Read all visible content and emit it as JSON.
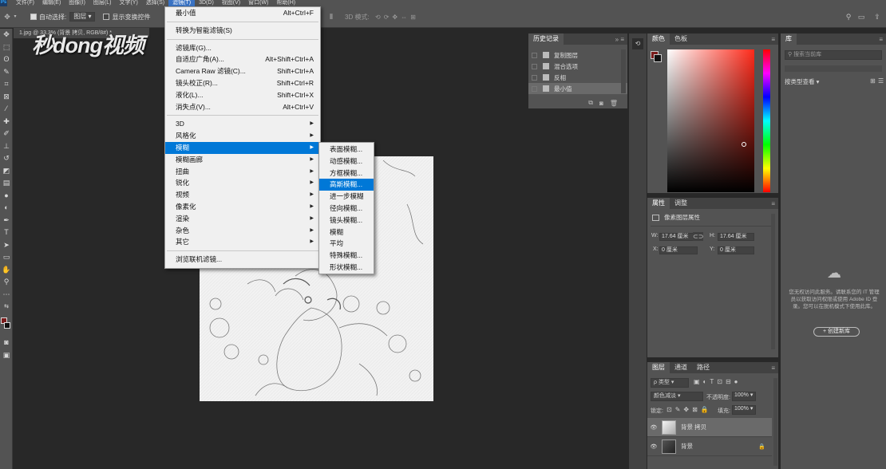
{
  "menubar": {
    "items": [
      "文件(F)",
      "编辑(E)",
      "图像(I)",
      "图层(L)",
      "文字(Y)",
      "选择(S)",
      "滤镜(T)",
      "3D(D)",
      "视图(V)",
      "窗口(W)",
      "帮助(H)"
    ],
    "active_index": 6,
    "app_icon": "Ps"
  },
  "options_bar": {
    "move_icon": "✥",
    "auto_select_label": "自动选择:",
    "auto_select_value": "图层",
    "show_transform_label": "显示变换控件",
    "mode_3d_label": "3D 模式:"
  },
  "document": {
    "tab_label": "1.jpg @ 33.3% (背景 拷贝, RGB/8#) *",
    "watermark": "秒dong视频"
  },
  "filter_menu": {
    "groups": [
      [
        {
          "label": "最小值",
          "shortcut": "Alt+Ctrl+F"
        }
      ],
      [
        {
          "label": "转换为智能滤镜(S)",
          "shortcut": ""
        }
      ],
      [
        {
          "label": "滤镜库(G)...",
          "shortcut": ""
        },
        {
          "label": "自适应广角(A)...",
          "shortcut": "Alt+Shift+Ctrl+A"
        },
        {
          "label": "Camera Raw 滤镜(C)...",
          "shortcut": "Shift+Ctrl+A"
        },
        {
          "label": "镜头校正(R)...",
          "shortcut": "Shift+Ctrl+R"
        },
        {
          "label": "液化(L)...",
          "shortcut": "Shift+Ctrl+X"
        },
        {
          "label": "消失点(V)...",
          "shortcut": "Alt+Ctrl+V"
        }
      ],
      [
        {
          "label": "3D",
          "submenu": true
        },
        {
          "label": "风格化",
          "submenu": true
        },
        {
          "label": "模糊",
          "submenu": true,
          "highlighted": true
        },
        {
          "label": "模糊画廊",
          "submenu": true
        },
        {
          "label": "扭曲",
          "submenu": true
        },
        {
          "label": "锐化",
          "submenu": true
        },
        {
          "label": "视频",
          "submenu": true
        },
        {
          "label": "像素化",
          "submenu": true
        },
        {
          "label": "渲染",
          "submenu": true
        },
        {
          "label": "杂色",
          "submenu": true
        },
        {
          "label": "其它",
          "submenu": true
        }
      ],
      [
        {
          "label": "浏览联机滤镜...",
          "shortcut": ""
        }
      ]
    ]
  },
  "blur_submenu": {
    "items": [
      "表面模糊...",
      "动感模糊...",
      "方框模糊...",
      "高斯模糊...",
      "进一步模糊",
      "径向模糊...",
      "镜头模糊...",
      "模糊",
      "平均",
      "特殊模糊...",
      "形状模糊..."
    ],
    "highlighted_index": 3
  },
  "history_panel": {
    "title": "历史记录",
    "items": [
      "复制图层",
      "混合选项",
      "反相",
      "最小值"
    ],
    "active_index": 3
  },
  "color_panel": {
    "tabs": [
      "颜色",
      "色板"
    ],
    "fg_color": "#7a1c1c",
    "hue_color": "#ff2a1a"
  },
  "properties_panel": {
    "tabs": [
      "属性",
      "调整"
    ],
    "subtitle": "像素图层属性",
    "w_label": "W:",
    "w_value": "17.64 厘米",
    "h_label": "H:",
    "h_value": "17.64 厘米",
    "x_label": "X:",
    "x_value": "0 厘米",
    "y_label": "Y:",
    "y_value": "0 厘米"
  },
  "layers_panel": {
    "tabs": [
      "图层",
      "通道",
      "路径"
    ],
    "filter_label": "类型",
    "blend_mode": "颜色减淡",
    "opacity_label": "不透明度:",
    "opacity_value": "100%",
    "lock_label": "锁定:",
    "fill_label": "填充:",
    "fill_value": "100%",
    "layers": [
      {
        "name": "背景 拷贝",
        "selected": true,
        "locked": false
      },
      {
        "name": "背景",
        "selected": false,
        "locked": true
      }
    ]
  },
  "library_panel": {
    "title": "库",
    "search_placeholder": "搜索当前库",
    "view_label": "按类型查看",
    "message": "您无权访问此服务。请联系您的 IT 管理员以获取访问权限或使用 Adobe ID 登录。您可以在脱机模式下使用此库。",
    "create_button": "+ 创建新库"
  }
}
